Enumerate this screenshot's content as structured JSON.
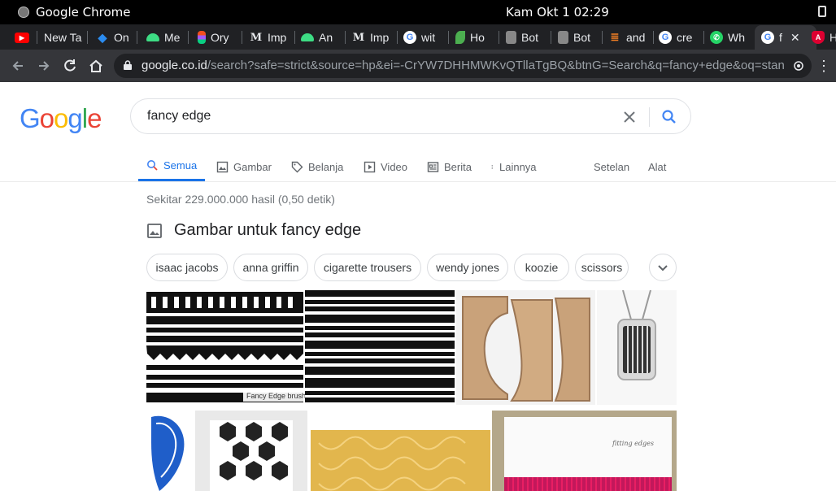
{
  "os": {
    "app_name": "Google Chrome",
    "clock": "Kam Okt 1  02:29"
  },
  "browser": {
    "tabs": [
      {
        "label": "",
        "icon": "youtube-icon",
        "color": "#ff0000"
      },
      {
        "label": "New Ta",
        "icon": "blank-tab-icon",
        "color": "#202124"
      },
      {
        "label": "On",
        "icon": "diamond-icon",
        "color": "#2b8cf0"
      },
      {
        "label": "Me",
        "icon": "android-icon",
        "color": "#3ddc84"
      },
      {
        "label": "Ory",
        "icon": "figma-icon",
        "color": "#a259ff"
      },
      {
        "label": "Imp",
        "icon": "medium-icon",
        "color": "#202124"
      },
      {
        "label": "An",
        "icon": "android-icon",
        "color": "#3ddc84"
      },
      {
        "label": "Imp",
        "icon": "medium-icon",
        "color": "#202124"
      },
      {
        "label": "wit",
        "icon": "google-icon",
        "color": "#e8eaed"
      },
      {
        "label": "Ho",
        "icon": "leaf-icon",
        "color": "#4caf50"
      },
      {
        "label": "Bot",
        "icon": "book-icon",
        "color": "#888888"
      },
      {
        "label": "Bot",
        "icon": "book-icon",
        "color": "#888888"
      },
      {
        "label": "and",
        "icon": "stack-icon",
        "color": "#f48024"
      },
      {
        "label": "cre",
        "icon": "google-icon",
        "color": "#e8eaed"
      },
      {
        "label": "Wh",
        "icon": "whatsapp-icon",
        "color": "#25d366"
      },
      {
        "label": "f",
        "icon": "google-icon",
        "color": "#e8eaed"
      },
      {
        "label": "H",
        "icon": "angular-icon",
        "color": "#dd0031"
      }
    ],
    "url_host": "google.co.id",
    "url_path": "/search?safe=strict&source=hp&ei=-CrYW7DHHMWKvQTllaTgBQ&btnG=Search&q=fancy+edge&oq=standar+d..."
  },
  "google": {
    "logo": "Google",
    "query": "fancy edge",
    "tabs": [
      {
        "label": "Semua",
        "icon": "search-icon"
      },
      {
        "label": "Gambar",
        "icon": "image-icon"
      },
      {
        "label": "Belanja",
        "icon": "tag-icon"
      },
      {
        "label": "Video",
        "icon": "play-icon"
      },
      {
        "label": "Berita",
        "icon": "news-icon"
      },
      {
        "label": "Lainnya",
        "icon": "more-vertical-icon"
      }
    ],
    "settings": "Setelan",
    "tools": "Alat",
    "result_stats": "Sekitar 229.000.000 hasil (0,50 detik)",
    "images_heading": "Gambar untuk fancy edge",
    "chips": [
      "isaac jacobs",
      "anna griffin",
      "cigarette trousers",
      "wendy jones",
      "koozie",
      "scissors"
    ],
    "thumb_caption": "Fancy Edge brushes",
    "card_text": "fitting edges"
  },
  "colors": {
    "accent": "#1a73e8",
    "google_blue": "#4285f4",
    "google_red": "#ea4335",
    "google_yellow": "#fbbc05",
    "google_green": "#34a853"
  }
}
